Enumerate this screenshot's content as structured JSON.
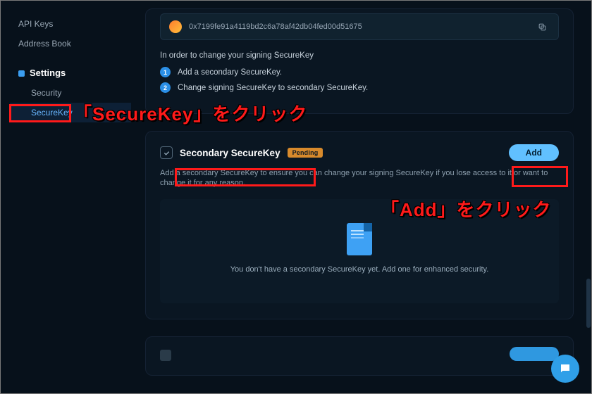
{
  "sidebar": {
    "items": [
      {
        "label": "API Keys"
      },
      {
        "label": "Address Book"
      }
    ],
    "group_label": "Settings",
    "subitems": [
      {
        "label": "Security"
      },
      {
        "label": "SecureKey"
      }
    ]
  },
  "panel_top": {
    "hash": "0x7199fe91a4119bd2c6a78af42db04fed00d51675",
    "instruction": "In order to change your signing SecureKey",
    "steps": [
      "Add a secondary SecureKey.",
      "Change signing SecureKey to secondary SecureKey."
    ]
  },
  "panel_secondary": {
    "title": "Secondary SecureKey",
    "badge": "Pending",
    "add_label": "Add",
    "description": "Add a secondary SecureKey to ensure you can change your signing SecureKey if you lose access to it or want to change it for any reason.",
    "empty_text": "You don't have a secondary SecureKey yet. Add one for enhanced security."
  },
  "annotations": {
    "a1": "「SecureKey」をクリック",
    "a2": "「Add」をクリック"
  }
}
